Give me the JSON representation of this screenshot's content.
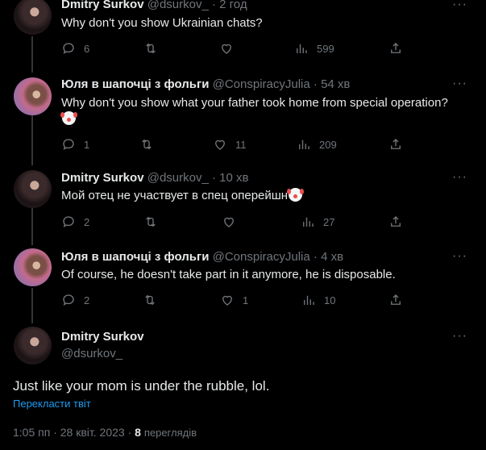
{
  "tweets": [
    {
      "name": "Dmitry Surkov",
      "handle": "@dsurkov_",
      "time": "2 год",
      "text": "Why don't you show Ukrainian chats?",
      "replies": "6",
      "retweets": "",
      "likes": "",
      "views": "599"
    },
    {
      "name": "Юля в шапочці з фольги",
      "handle": "@ConspiracyJulia",
      "time": "54 хв",
      "text": "Why don't you show what your father took home from special operation?",
      "replies": "1",
      "retweets": "",
      "likes": "11",
      "views": "209"
    },
    {
      "name": "Dmitry Surkov",
      "handle": "@dsurkov_",
      "time": "10 хв",
      "text": "Мой отец не участвует в спец оперейшн",
      "replies": "2",
      "retweets": "",
      "likes": "",
      "views": "27"
    },
    {
      "name": "Юля в шапочці з фольги",
      "handle": "@ConspiracyJulia",
      "time": "4 хв",
      "text": "Of course, he doesn't take part in it anymore, he is disposable.",
      "replies": "2",
      "retweets": "",
      "likes": "1",
      "views": "10"
    }
  ],
  "main_tweet": {
    "name": "Dmitry Surkov",
    "handle": "@dsurkov_",
    "text": "Just like your mom is under the rubble, lol.",
    "translate_label": "Перекласти твіт",
    "time": "1:05 пп",
    "date": "28 квіт. 2023",
    "views_count": "8",
    "views_label": "переглядів"
  },
  "sep": "·",
  "more_glyph": "···",
  "icons": {
    "reply": "reply-icon",
    "retweet": "retweet-icon",
    "like": "heart-icon",
    "views": "views-icon",
    "share": "share-icon",
    "emoji": "clown-face-emoji"
  },
  "colors": {
    "background": "#000000",
    "text": "#e7e9ea",
    "muted": "#71767b",
    "link": "#1d9bf0",
    "divider": "#2f3336"
  }
}
